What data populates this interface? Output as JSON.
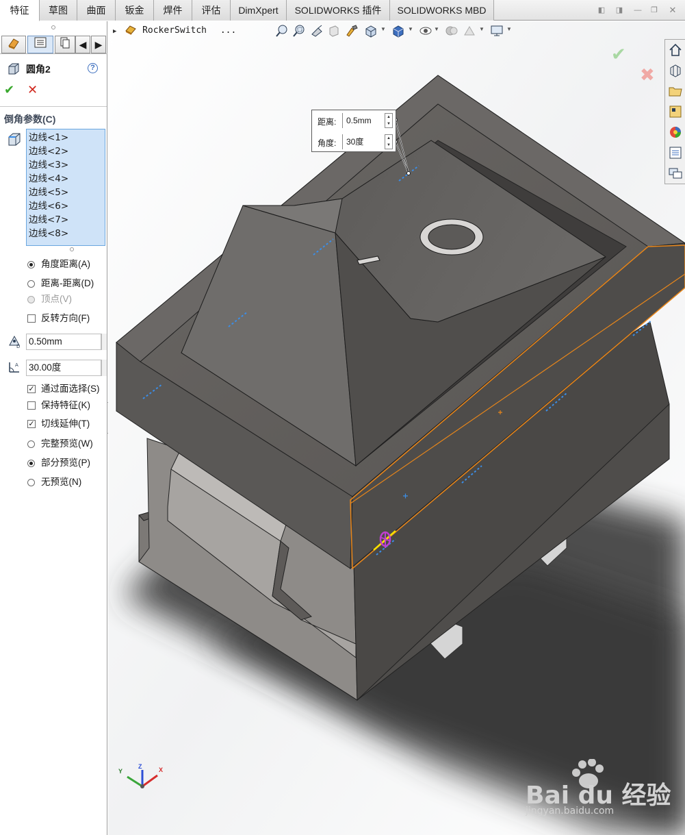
{
  "tabs": [
    "特征",
    "草图",
    "曲面",
    "钣金",
    "焊件",
    "评估",
    "DimXpert",
    "SOLIDWORKS 插件",
    "SOLIDWORKS MBD"
  ],
  "active_tab": "特征",
  "feature": {
    "title": "圆角2",
    "help_label": "?"
  },
  "group": {
    "title": "倒角参数(C)",
    "edges": [
      "边线<1>",
      "边线<2>",
      "边线<3>",
      "边线<4>",
      "边线<5>",
      "边线<6>",
      "边线<7>",
      "边线<8>"
    ]
  },
  "options": {
    "angle_distance": "角度距离(A)",
    "distance_distance": "距离-距离(D)",
    "vertex": "顶点(V)",
    "reverse": "反转方向(F)",
    "distance_value": "0.50mm",
    "angle_value": "30.00度",
    "select_through_faces": "通过面选择(S)",
    "keep_features": "保持特征(K)",
    "tangent_propagation": "切线延伸(T)",
    "full_preview": "完整预览(W)",
    "partial_preview": "部分预览(P)",
    "no_preview": "无预览(N)"
  },
  "breadcrumb": {
    "part": "RockerSwitch",
    "ellipsis": "..."
  },
  "callout": {
    "distance_label": "距离:",
    "distance_value": "0.5mm",
    "angle_label": "角度:",
    "angle_value": "30度"
  },
  "symbols": {
    "switch_off": "O",
    "switch_on": "|"
  },
  "triad": {
    "x": "X",
    "y": "Y",
    "z": "Z"
  },
  "watermark": {
    "brand": "Bai du 经验",
    "url": "jingyan.baidu.com"
  },
  "colors": {
    "body": "#5f5d5b",
    "selected_edge": "#e8861a",
    "preview_edge": "#3b8ee8",
    "accept": "#39a82d",
    "cancel": "#d0281e"
  }
}
